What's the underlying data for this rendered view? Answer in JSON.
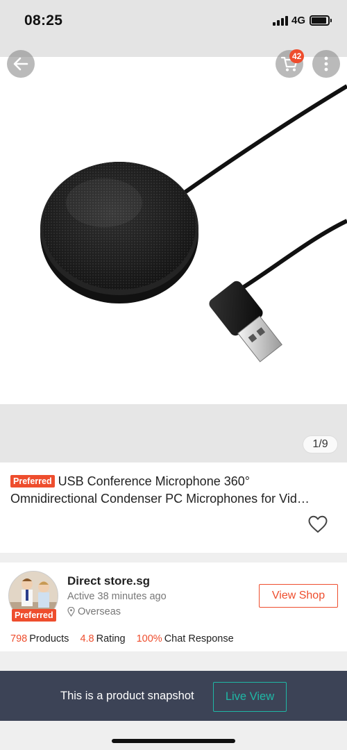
{
  "status_bar": {
    "time": "08:25",
    "network": "4G"
  },
  "product": {
    "image_counter": "1/9",
    "preferred_label": "Preferred",
    "title_line1": "USB Conference Microphone 360°",
    "title_line2": "Omnidirectional Condenser PC Microphones for Vid…"
  },
  "header": {
    "cart_count": "42"
  },
  "icons": {
    "back": "arrow-left-icon",
    "cart": "shopping-cart-icon",
    "more": "more-vertical-icon",
    "wishlist": "heart-outline-icon",
    "location": "map-pin-icon"
  },
  "shop": {
    "name": "Direct store.sg",
    "active": "Active 38 minutes ago",
    "location": "Overseas",
    "preferred_label": "Preferred",
    "view_shop_label": "View Shop",
    "stats": [
      {
        "value": "798",
        "label": "Products"
      },
      {
        "value": "4.8",
        "label": "Rating"
      },
      {
        "value": "100%",
        "label": "Chat Response"
      }
    ]
  },
  "snapshot": {
    "message": "This is a product snapshot",
    "live_view_label": "Live View"
  },
  "colors": {
    "accent": "#ee4d2d",
    "teal": "#1fb8a6",
    "banner": "#3c4356"
  }
}
